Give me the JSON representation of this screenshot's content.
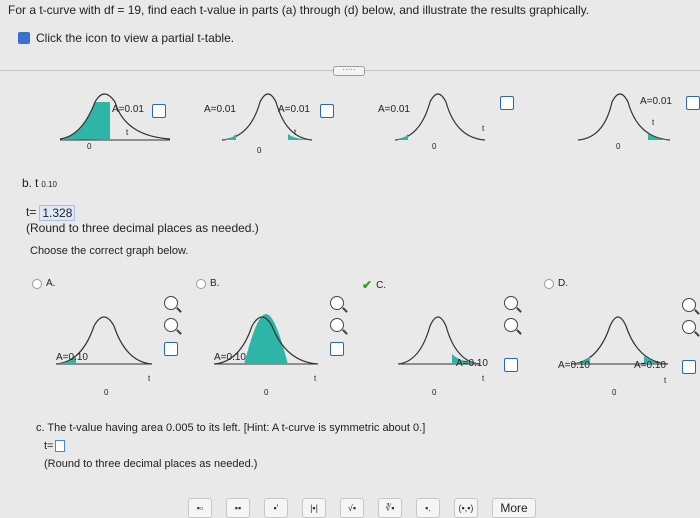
{
  "header": {
    "question": "For a t-curve with df = 19, find each t-value in parts (a) through (d) below, and illustrate the results graphically.",
    "table_link": "Click the icon to view a partial t-table."
  },
  "more_dots": "·····",
  "top_graphs": [
    {
      "area_label": "A=0.01",
      "zero": "0",
      "t": "t"
    },
    {
      "area_label_left": "A=0.01",
      "area_label_right": "A=0.01",
      "zero": "0",
      "t": "t"
    },
    {
      "area_label": "A=0.01",
      "zero": "0",
      "t": "t"
    },
    {
      "area_label": "A=0.01",
      "zero": "0",
      "t": "t"
    }
  ],
  "part_b": {
    "label": "b.",
    "t_sub": "t",
    "sub": "0.10",
    "answer_prefix": "t=",
    "answer_value": "1.328",
    "rounding_note": "(Round to three decimal places as needed.)",
    "choose_prompt": "Choose the correct graph below.",
    "options": [
      {
        "letter": "A.",
        "area_label": "A=0.10",
        "zero": "0",
        "t": "t"
      },
      {
        "letter": "B.",
        "area_label": "A=0.10",
        "zero": "0",
        "t": "t"
      },
      {
        "letter": "C.",
        "area_label": "A=0.10",
        "zero": "0",
        "t": "t"
      },
      {
        "letter": "D.",
        "area_label_left": "A=0.10",
        "area_label_right": "A=0.10",
        "zero": "0",
        "t": "t"
      }
    ],
    "selected": "C."
  },
  "part_c": {
    "question": "c. The t-value having area 0.005 to its left. [Hint: A t-curve is symmetric about 0.]",
    "answer_prefix": "t=",
    "rounding_note": "(Round to three decimal places as needed.)"
  },
  "toolbar": {
    "buttons": [
      "▪▫",
      "▪▪",
      "▪'",
      "|▪|",
      "√▪",
      "∛▪",
      "▪.",
      "(▪,▪)"
    ],
    "more_label": "More"
  },
  "colors": {
    "fill": "#2fb5a8",
    "link": "#2b67b0",
    "check": "#3a9a2a"
  }
}
